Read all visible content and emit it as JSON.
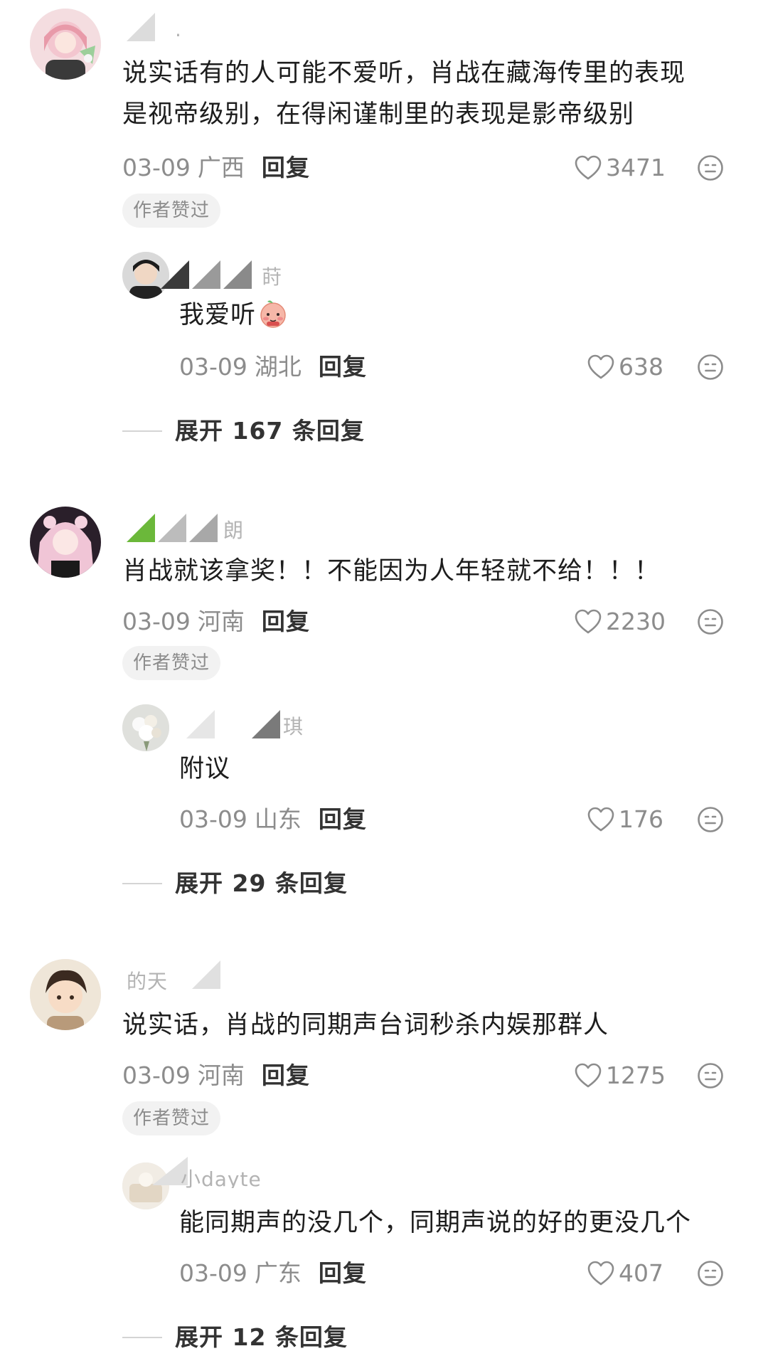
{
  "threads": [
    {
      "comment": {
        "avatar_icon": "avatar-pink-hair-girl",
        "username": ".",
        "lines": [
          "说实话有的人可能不爱听，肖战在藏海传里的表现",
          "是视帝级别，在得闲谨制里的表现是影帝级别"
        ],
        "date": "03-09",
        "region": "广西",
        "reply_label": "回复",
        "likes": "3471",
        "author_badge": "作者赞过"
      },
      "reply": {
        "avatar_icon": "avatar-man-dark-hair",
        "username": "莳暇",
        "text": "我爱听",
        "text_emoji": "blushing-peach-emoji",
        "date": "03-09",
        "region": "湖北",
        "reply_label": "回复",
        "likes": "638"
      },
      "expand_label": "展开 167 条回复"
    },
    {
      "comment": {
        "avatar_icon": "avatar-anime-girl-pink",
        "username": "朗",
        "lines": [
          "肖战就该拿奖！！不能因为人年轻就不给！！！"
        ],
        "date": "03-09",
        "region": "河南",
        "reply_label": "回复",
        "likes": "2230",
        "author_badge": "作者赞过"
      },
      "reply": {
        "avatar_icon": "avatar-white-flowers",
        "username": "琪",
        "text": "附议",
        "date": "03-09",
        "region": "山东",
        "reply_label": "回复",
        "likes": "176"
      },
      "expand_label": "展开 29 条回复"
    },
    {
      "comment": {
        "avatar_icon": "avatar-anime-boy",
        "username": "的天",
        "lines": [
          "说实话，肖战的同期声台词秒杀内娱那群人"
        ],
        "date": "03-09",
        "region": "河南",
        "reply_label": "回复",
        "likes": "1275",
        "author_badge": "作者赞过"
      },
      "reply": {
        "avatar_icon": "avatar-cream-photo",
        "username": "小dayte",
        "text": "能同期声的没几个，同期声说的好的更没几个",
        "date": "03-09",
        "region": "广东",
        "reply_label": "回复",
        "likes": "407"
      },
      "expand_label": "展开 12 条回复"
    }
  ],
  "colors": {
    "text_primary": "#1d1d1d",
    "text_secondary": "#8c8c8c",
    "badge_bg": "#f2f2f2",
    "divider": "#d4d4d4"
  }
}
